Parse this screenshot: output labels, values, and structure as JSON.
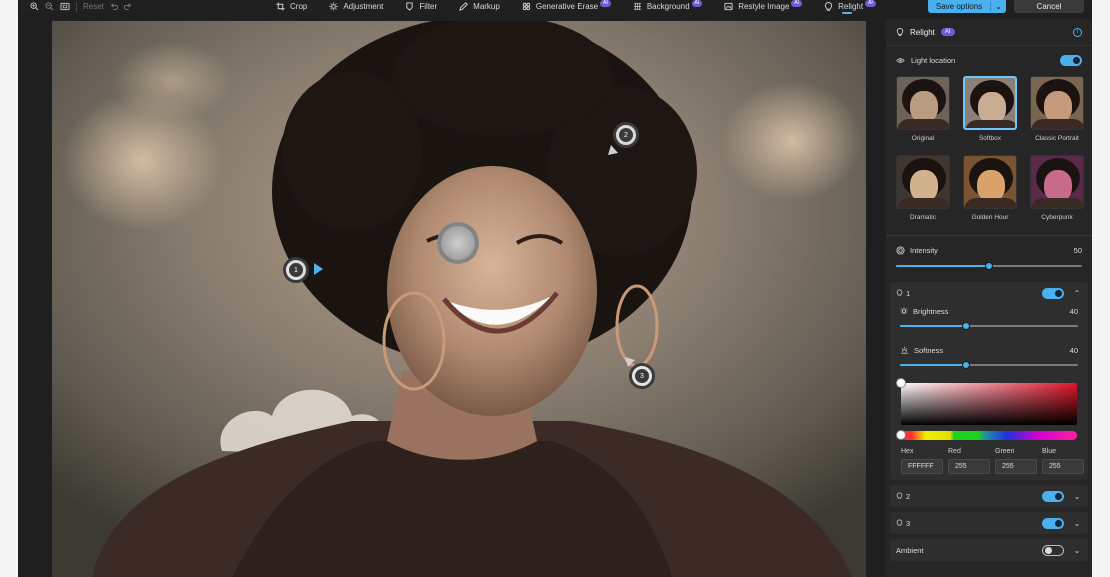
{
  "toolbar": {
    "reset_label": "Reset",
    "tools": [
      {
        "label": "Crop",
        "icon": "crop-icon",
        "ai": false
      },
      {
        "label": "Adjustment",
        "icon": "sun-icon",
        "ai": false
      },
      {
        "label": "Filter",
        "icon": "filter-icon",
        "ai": false
      },
      {
        "label": "Markup",
        "icon": "pen-icon",
        "ai": false
      },
      {
        "label": "Generative Erase",
        "icon": "erase-icon",
        "ai": true
      },
      {
        "label": "Background",
        "icon": "background-icon",
        "ai": true
      },
      {
        "label": "Restyle Image",
        "icon": "restyle-icon",
        "ai": true
      },
      {
        "label": "Relight",
        "icon": "bulb-icon",
        "ai": true
      }
    ],
    "ai_badge": "AI",
    "save_label": "Save options",
    "cancel_label": "Cancel"
  },
  "canvas": {
    "handles": [
      "1",
      "2",
      "3"
    ]
  },
  "panel": {
    "title": "Relight",
    "ai_badge": "AI",
    "light_location_label": "Light location",
    "light_location_on": true,
    "presets": [
      {
        "name": "Original",
        "selected": false,
        "tone": "#b89c82",
        "bg": "#6d6258"
      },
      {
        "name": "Softbox",
        "selected": true,
        "tone": "#c9ad92",
        "bg": "#8a8076"
      },
      {
        "name": "Classic Portrait",
        "selected": false,
        "tone": "#c49a7a",
        "bg": "#7a6650"
      },
      {
        "name": "Dramatic",
        "selected": false,
        "tone": "#d2b28c",
        "bg": "#3e3630"
      },
      {
        "name": "Golden Hour",
        "selected": false,
        "tone": "#d8a26a",
        "bg": "#7a5430"
      },
      {
        "name": "Cyberpunk",
        "selected": false,
        "tone": "#c86a8a",
        "bg": "#5a2a4a"
      }
    ],
    "intensity": {
      "label": "Intensity",
      "value": "50",
      "fraction": 0.5
    },
    "light1": {
      "label": "1",
      "on": true,
      "brightness": {
        "label": "Brightness",
        "value": "40",
        "fraction": 0.37
      },
      "softness": {
        "label": "Softness",
        "value": "40",
        "fraction": 0.37
      }
    },
    "color": {
      "hex_label": "Hex",
      "red_label": "Red",
      "green_label": "Green",
      "blue_label": "Blue",
      "hex": "FFFFFF",
      "red": "255",
      "green": "255",
      "blue": "255"
    },
    "light2": {
      "label": "2",
      "on": true
    },
    "light3": {
      "label": "3",
      "on": true
    },
    "ambient": {
      "label": "Ambient",
      "on": false
    },
    "accent": "#4ab0ee"
  }
}
